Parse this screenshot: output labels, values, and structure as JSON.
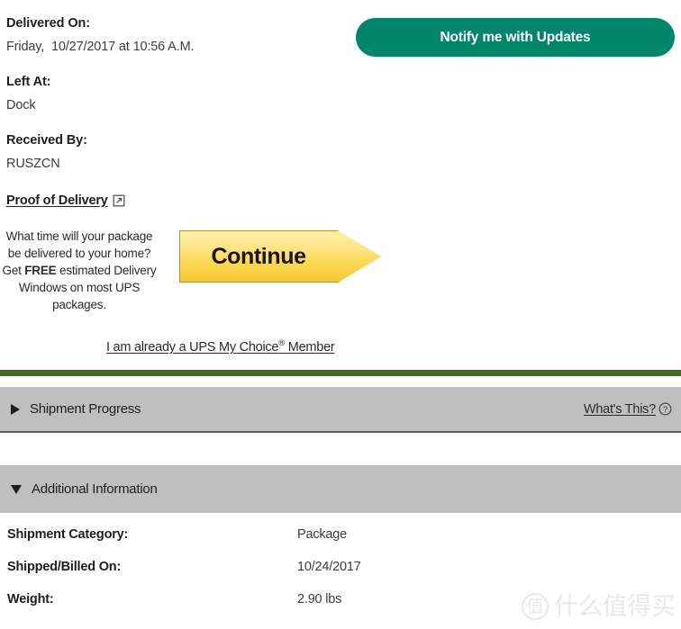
{
  "delivery": {
    "delivered_on_label": "Delivered On:",
    "delivered_on_value": "Friday,  10/27/2017 at 10:56 A.M.",
    "left_at_label": "Left At:",
    "left_at_value": "Dock",
    "received_by_label": "Received By:",
    "received_by_value": "RUSZCN",
    "proof_of_delivery_label": "Proof of Delivery",
    "proof_of_delivery_icon": "external-link-icon"
  },
  "notify": {
    "label": "Notify me with Updates",
    "color": "#00866a"
  },
  "promo": {
    "text_part1": "What time will your package be delivered to your home? Get ",
    "text_free": "FREE",
    "text_part2": " estimated Delivery Windows on most UPS packages.",
    "continue_label": "Continue",
    "continue_color": "#fcd94f",
    "member_link_part1": "I am already a UPS My Choice",
    "member_link_sup": "®",
    "member_link_part2": " Member"
  },
  "divider": {
    "color": "#426b24"
  },
  "sections": {
    "shipment_progress": {
      "title": "Shipment Progress",
      "expanded": false,
      "toggle_icon": "triangle-right-icon",
      "whats_this_label": "What's This?",
      "whats_this_icon": "question-circle-icon"
    },
    "additional_information": {
      "title": "Additional Information",
      "expanded": true,
      "toggle_icon": "triangle-down-icon",
      "rows": [
        {
          "label": "Shipment Category:",
          "value": "Package"
        },
        {
          "label": "Shipped/Billed On:",
          "value": "10/24/2017"
        },
        {
          "label": "Weight:",
          "value": "2.90 lbs"
        }
      ]
    }
  },
  "watermark": {
    "badge": "值",
    "text": "什么值得买"
  }
}
